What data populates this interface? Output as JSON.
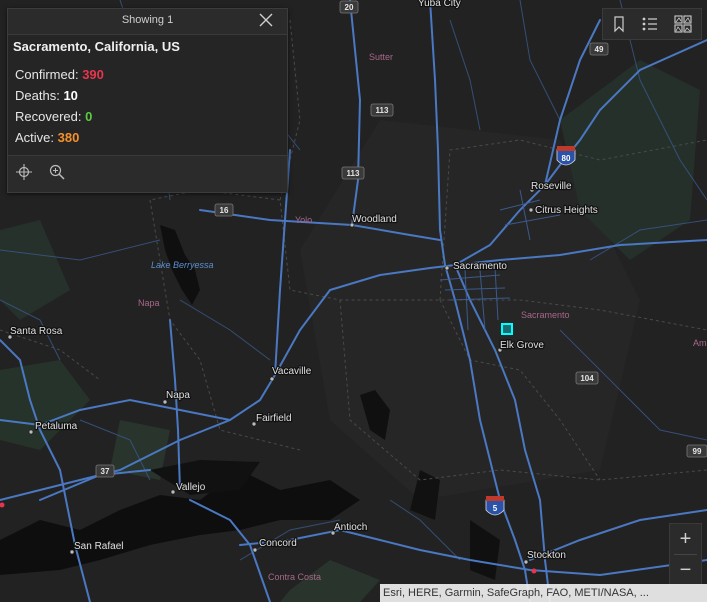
{
  "popup": {
    "count_label": "Showing 1",
    "title": "Sacramento, California, US",
    "stats": {
      "confirmed_label": "Confirmed:",
      "confirmed_value": "390",
      "confirmed_color": "#e8344e",
      "deaths_label": "Deaths:",
      "deaths_value": "10",
      "deaths_color": "#ffffff",
      "recovered_label": "Recovered:",
      "recovered_value": "0",
      "recovered_color": "#5ccb3f",
      "active_label": "Active:",
      "active_value": "380",
      "active_color": "#f5912c"
    },
    "tools": [
      "move-icon",
      "zoom-to-icon"
    ]
  },
  "toolbar": {
    "buttons": [
      "bookmark-icon",
      "legend-icon",
      "basemap-gallery-icon"
    ]
  },
  "zoom": {
    "in_label": "+",
    "out_label": "−"
  },
  "attribution": "Esri, HERE, Garmin, SafeGraph, FAO, METI/NASA, ...",
  "map": {
    "cities": [
      "Yuba City",
      "Roseville",
      "Citrus Heights",
      "Woodland",
      "Sacramento",
      "Elk Grove",
      "Santa Rosa",
      "Vacaville",
      "Napa",
      "Fairfield",
      "Petaluma",
      "Vallejo",
      "San Rafael",
      "Antioch",
      "Concord",
      "Stockton"
    ],
    "counties": [
      "Sutter",
      "Yolo",
      "Napa",
      "Sacramento",
      "Contra Costa",
      "Ama"
    ],
    "lakes": [
      "Lake Berryessa"
    ],
    "highway_shields": [
      "20",
      "49",
      "113",
      "113",
      "16",
      "104",
      "37",
      "99"
    ],
    "interstate_shields": [
      "80",
      "5"
    ],
    "highlight_color": "#00ffff",
    "road_color": "#4a78c2"
  }
}
